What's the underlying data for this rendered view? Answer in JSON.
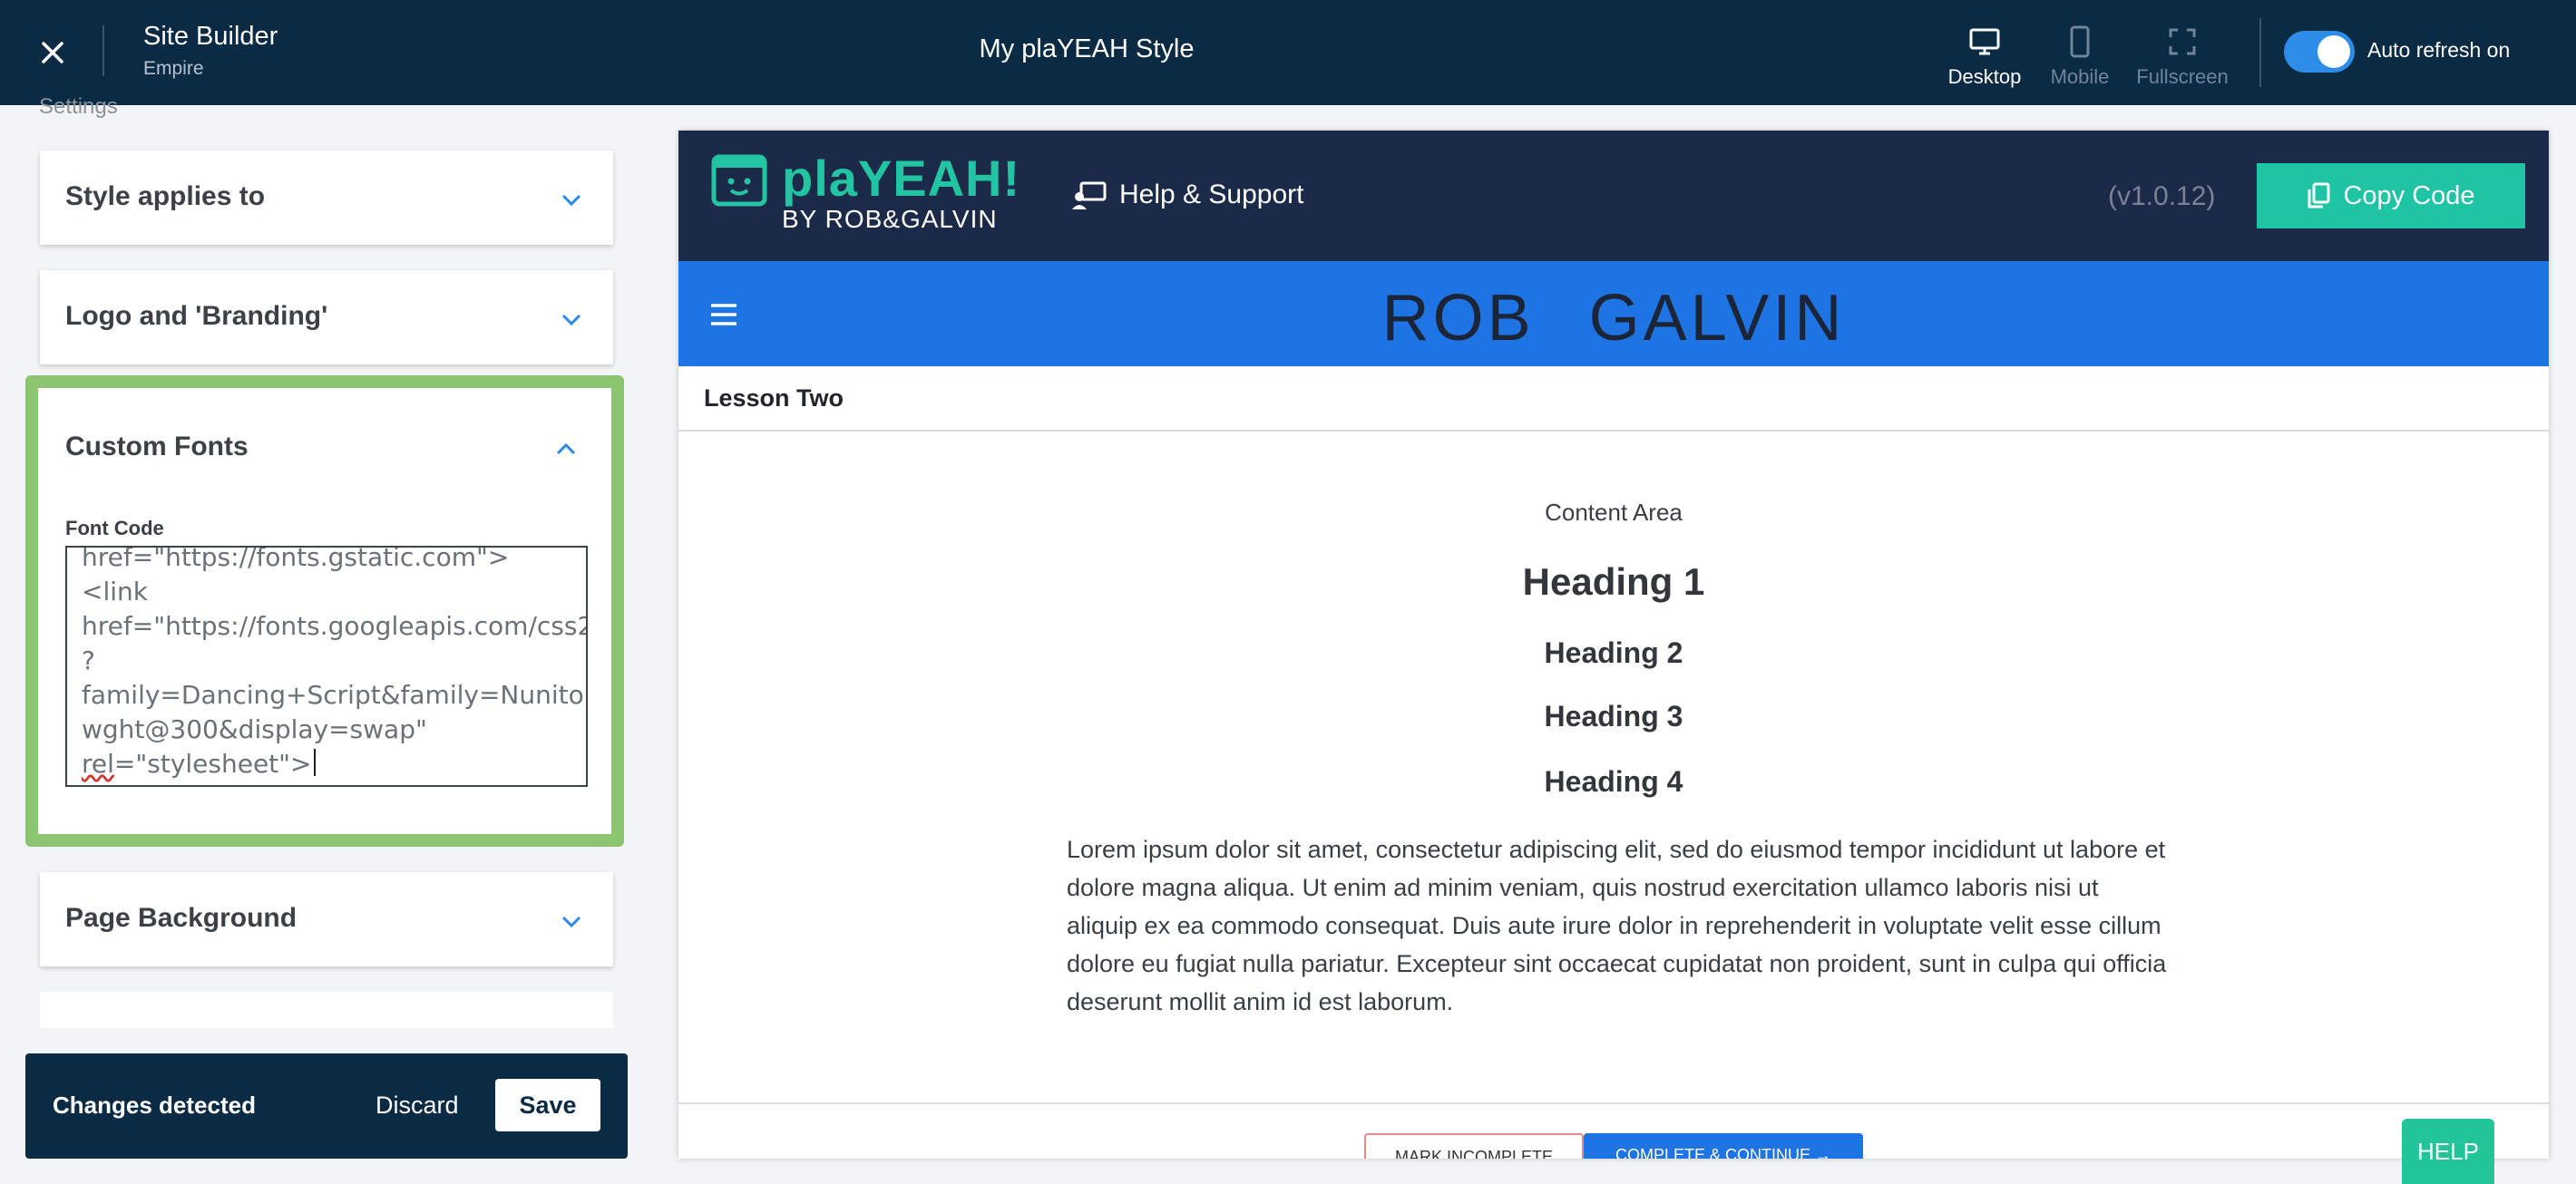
{
  "topbar": {
    "app_title": "Site Builder",
    "app_subtitle": "Empire",
    "page_title": "My plaYEAH Style",
    "views": [
      {
        "label": "Desktop",
        "icon": "desktop-icon",
        "active": true
      },
      {
        "label": "Mobile",
        "icon": "mobile-icon",
        "active": false
      },
      {
        "label": "Fullscreen",
        "icon": "fullscreen-icon",
        "active": false
      }
    ],
    "auto_refresh_label": "Auto refresh on",
    "auto_refresh_on": true
  },
  "sidebar": {
    "section_label": "Settings",
    "accordions": {
      "style_applies": "Style applies to",
      "logo_branding": "Logo and 'Branding'",
      "custom_fonts": "Custom Fonts",
      "page_background": "Page Background"
    },
    "font_code_label": "Font Code",
    "font_code_lines": [
      "href=\"https://fonts.gstatic.com\">",
      "<link",
      "href=\"https://fonts.googleapis.com/css2",
      "?",
      "family=Dancing+Script&family=Nunito:",
      "wght@300&display=swap\"",
      "rel",
      "=\"stylesheet\">"
    ],
    "changes": {
      "message": "Changes detected",
      "discard": "Discard",
      "save": "Save"
    }
  },
  "preview": {
    "logo_text": "plaYEAH!",
    "logo_sub": "BY ROB&GALVIN",
    "help_support": "Help & Support",
    "version": "(v1.0.12)",
    "copy_code": "Copy Code",
    "brand": "ROB GALVIN",
    "lesson_title": "Lesson Two",
    "content_area": "Content Area",
    "h1": "Heading 1",
    "h2": "Heading 2",
    "h3": "Heading 3",
    "h4": "Heading 4",
    "lorem": "Lorem ipsum dolor sit amet, consectetur adipiscing elit, sed do eiusmod tempor incididunt ut labore et dolore magna aliqua. Ut enim ad minim veniam, quis nostrud exercitation ullamco laboris nisi ut aliquip ex ea commodo consequat. Duis aute irure dolor in reprehenderit in voluptate velit esse cillum dolore eu fugiat nulla pariatur. Excepteur sint occaecat cupidatat non proident, sunt in culpa qui officia deserunt mollit anim id est laborum.",
    "mark_incomplete": "MARK INCOMPLETE",
    "complete_continue": "COMPLETE & CONTINUE →"
  },
  "help_button": "HELP",
  "colors": {
    "topbar_bg": "#0b2a44",
    "accent_blue": "#1e74e3",
    "teal": "#1fc4a4",
    "active_border": "#8cc56f"
  }
}
